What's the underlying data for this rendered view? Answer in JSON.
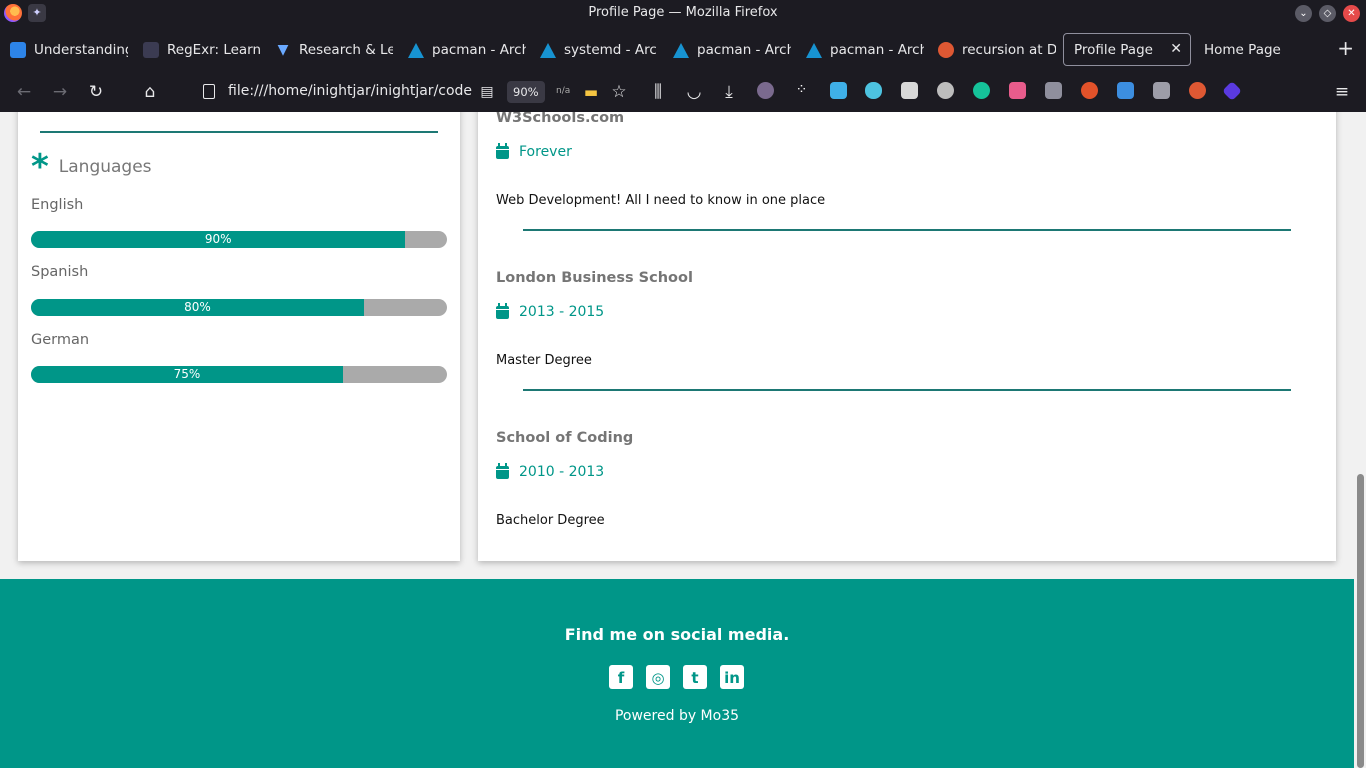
{
  "window": {
    "title": "Profile Page — Mozilla Firefox"
  },
  "tabs": [
    {
      "label": "Understanding",
      "icon": "video-icon"
    },
    {
      "label": "RegExr: Learn,",
      "icon": "regex-icon"
    },
    {
      "label": "Research & Le",
      "icon": "v-icon"
    },
    {
      "label": "pacman - Arch",
      "icon": "arch-icon"
    },
    {
      "label": "systemd - Arc",
      "icon": "arch-icon"
    },
    {
      "label": "pacman - Arch",
      "icon": "arch-icon"
    },
    {
      "label": "pacman - Arch",
      "icon": "arch-icon"
    },
    {
      "label": "recursion at D",
      "icon": "duckduckgo-icon"
    },
    {
      "label": "Profile Page",
      "icon": "",
      "active": true
    },
    {
      "label": "Home Page",
      "icon": ""
    }
  ],
  "nav": {
    "url": "file:///home/inightjar/inightjar/codeR",
    "zoom": "90%",
    "na": "n/a"
  },
  "colors": {
    "accent": "#009688",
    "divider": "#1d7874",
    "bar_bg": "#aaaaaa"
  },
  "languages": {
    "title": "Languages",
    "items": [
      {
        "name": "English",
        "percent": 90,
        "label": "90%"
      },
      {
        "name": "Spanish",
        "percent": 80,
        "label": "80%"
      },
      {
        "name": "German",
        "percent": 75,
        "label": "75%"
      }
    ]
  },
  "education": [
    {
      "school": "W3Schools.com",
      "date": "Forever",
      "desc": "Web Development! All I need to know in one place"
    },
    {
      "school": "London Business School",
      "date": "2013 - 2015",
      "desc": "Master Degree"
    },
    {
      "school": "School of Coding",
      "date": "2010 - 2013",
      "desc": "Bachelor Degree"
    }
  ],
  "footer": {
    "heading": "Find me on social media.",
    "socials": [
      "facebook-icon",
      "instagram-icon",
      "twitter-icon",
      "linkedin-icon"
    ],
    "powered": "Powered by Mo35"
  }
}
